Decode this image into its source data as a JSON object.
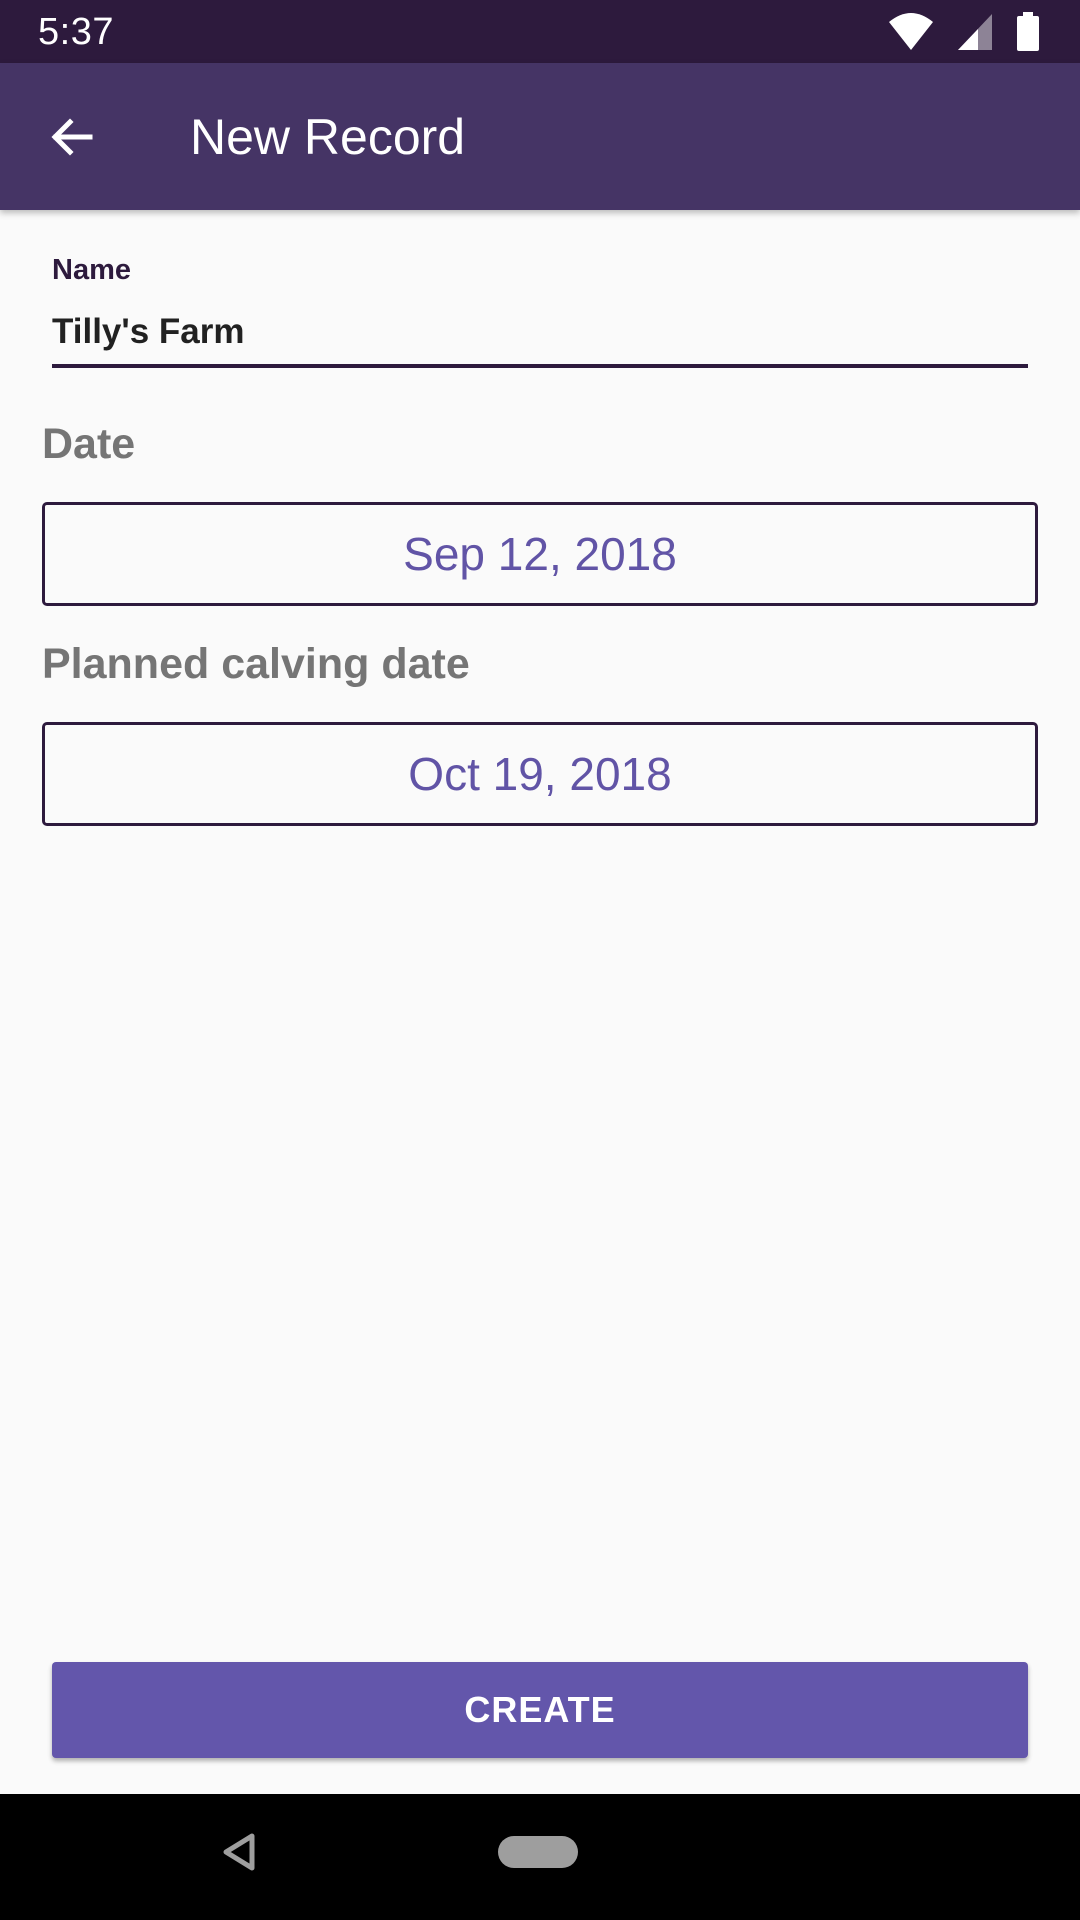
{
  "status_bar": {
    "time": "5:37",
    "icons": [
      "wifi-icon",
      "signal-icon",
      "battery-icon"
    ]
  },
  "app_bar": {
    "title": "New Record",
    "back_icon": "arrow-back-icon"
  },
  "form": {
    "name_label": "Name",
    "name_value": "Tilly's Farm",
    "date_label": "Date",
    "date_value": "Sep 12, 2018",
    "calving_label": "Planned calving date",
    "calving_value": "Oct 19, 2018"
  },
  "actions": {
    "create_label": "CREATE"
  },
  "colors": {
    "status_bar": "#2d1a3d",
    "app_bar": "#453465",
    "accent": "#6356ab",
    "date_text": "#6154a6",
    "label_gray": "#757575"
  },
  "nav_bar": {
    "icons": [
      "nav-back-icon",
      "nav-home-pill"
    ]
  }
}
